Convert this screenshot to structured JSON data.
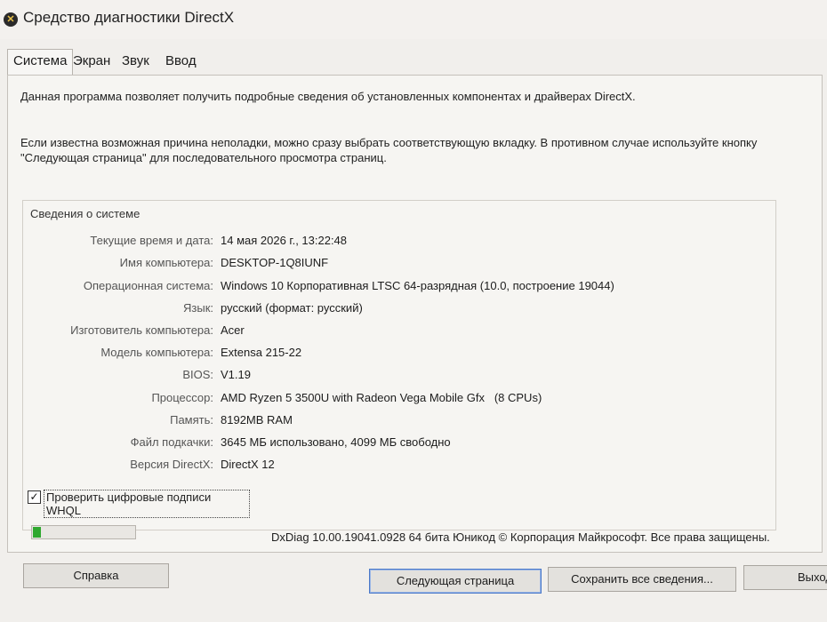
{
  "window": {
    "title": "Средство диагностики DirectX",
    "icon": "directx-icon"
  },
  "tabs": [
    {
      "label": "Система",
      "active": true
    },
    {
      "label": "Экран",
      "active": false
    },
    {
      "label": "Звук",
      "active": false
    },
    {
      "label": "Ввод",
      "active": false
    }
  ],
  "intro": {
    "line1": "Данная программа позволяет получить подробные сведения об установленных компонентах и драйверах DirectX.",
    "line2": "Если известна возможная причина неполадки, можно сразу выбрать соответствующую вкладку. В противном случае используйте кнопку \"Следующая страница\" для последовательного просмотра страниц."
  },
  "system_info": {
    "title": "Сведения о системе",
    "rows": [
      {
        "label": "Текущие время и дата:",
        "value": "14 мая 2026 г., 13:22:48"
      },
      {
        "label": "Имя компьютера:",
        "value": "DESKTOP-1Q8IUNF"
      },
      {
        "label": "Операционная система:",
        "value": "Windows 10 Корпоративная LTSC 64-разрядная (10.0, построение 19044)"
      },
      {
        "label": "Язык:",
        "value": "русский (формат: русский)"
      },
      {
        "label": "Изготовитель компьютера:",
        "value": "Acer"
      },
      {
        "label": "Модель компьютера:",
        "value": "Extensa 215-22"
      },
      {
        "label": "BIOS:",
        "value": "V1.19"
      },
      {
        "label": "Процессор:",
        "value": "AMD Ryzen 5 3500U with Radeon Vega Mobile Gfx   (8 CPUs)"
      },
      {
        "label": "Память:",
        "value": "8192MB RAM"
      },
      {
        "label": "Файл подкачки:",
        "value": "3645 МБ использовано, 4099 МБ свободно"
      },
      {
        "label": "Версия DirectX:",
        "value": "DirectX 12"
      }
    ]
  },
  "whql_checkbox": {
    "label": "Проверить цифровые подписи WHQL",
    "checked": true,
    "mark": "✓"
  },
  "progress": {
    "fraction": 0.08,
    "color": "#2fa82f"
  },
  "footer": {
    "text": "DxDiag 10.00.19041.0928 64 бита Юникод © Корпорация Майкрософт. Все права защищены."
  },
  "buttons": {
    "help": "Справка",
    "next_page": "Следующая страница",
    "save_all": "Сохранить все сведения...",
    "exit": "Выход"
  }
}
